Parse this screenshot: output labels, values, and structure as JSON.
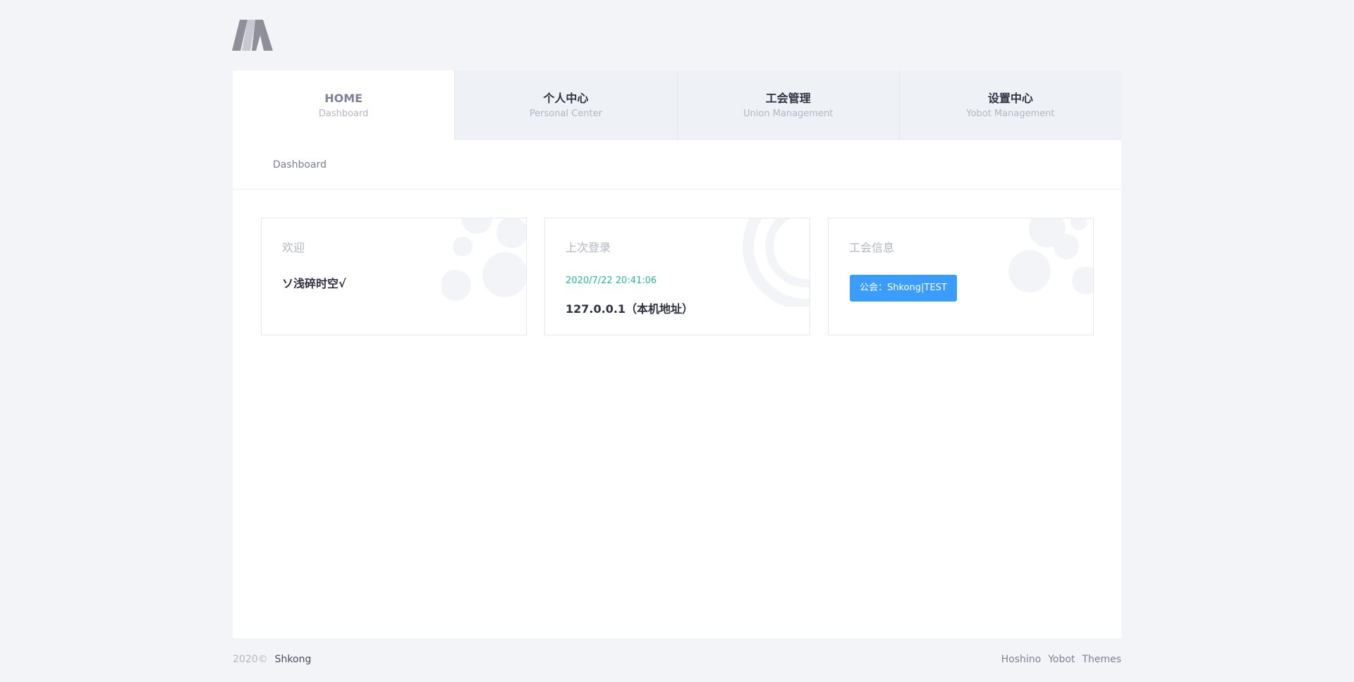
{
  "logo": {
    "icon": "brand-logo-icon"
  },
  "nav": {
    "tabs": [
      {
        "title": "HOME",
        "subtitle": "Dashboard"
      },
      {
        "title": "个人中心",
        "subtitle": "Personal Center"
      },
      {
        "title": "工会管理",
        "subtitle": "Union Management"
      },
      {
        "title": "设置中心",
        "subtitle": "Yobot Management"
      }
    ]
  },
  "subnav": {
    "link": "Dashboard"
  },
  "cards": {
    "welcome": {
      "label": "欢迎",
      "name": "ソ浅碎时空√"
    },
    "last_login": {
      "label": "上次登录",
      "time": "2020/7/22 20:41:06",
      "ip": "127.0.0.1（本机地址）"
    },
    "guild": {
      "label": "工会信息",
      "badge": "公会：Shkong|TEST"
    }
  },
  "footer": {
    "copyright": "2020©",
    "owner": "Shkong",
    "links": [
      "Hoshino",
      "Yobot",
      "Themes"
    ]
  },
  "colors": {
    "background": "#f2f4f7",
    "accent_teal": "#2bb3a1",
    "badge_blue": "#3a9cfb"
  }
}
